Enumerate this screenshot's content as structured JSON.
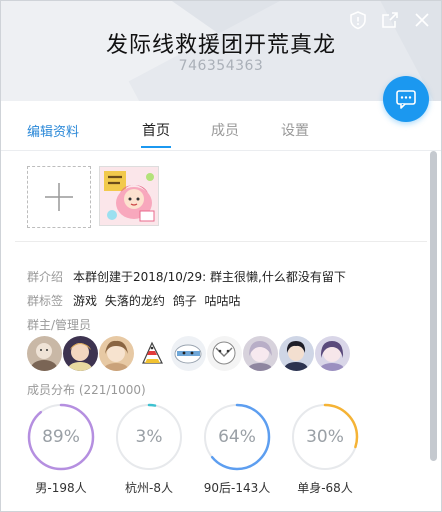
{
  "group": {
    "name": "发际线救援团开荒真龙",
    "id": "746354363"
  },
  "window_buttons": [
    "shield-icon",
    "share-icon",
    "close-icon"
  ],
  "tabs": {
    "edit_label": "编辑资料",
    "items": [
      {
        "label": "首页",
        "active": true
      },
      {
        "label": "成员",
        "active": false
      },
      {
        "label": "设置",
        "active": false
      }
    ]
  },
  "info": {
    "intro_label": "群介绍",
    "intro_text": "本群创建于2018/10/29:  群主很懒,什么都没有留下",
    "tags_label": "群标签",
    "tags": [
      "游戏",
      "失落的龙约",
      "鸽子",
      "咕咕咕"
    ]
  },
  "admins": {
    "title": "群主/管理员",
    "count": 9
  },
  "distribution": {
    "title": "成员分布",
    "summary": "(221/1000)",
    "items": [
      {
        "value": "89%",
        "percent": 89,
        "label": "男-198人",
        "color": "#b58fe0"
      },
      {
        "value": "3%",
        "percent": 3,
        "label": "杭州-8人",
        "color": "#3ec1d0"
      },
      {
        "value": "64%",
        "percent": 64,
        "label": "90后-143人",
        "color": "#5d9ef0"
      },
      {
        "value": "30%",
        "percent": 30,
        "label": "单身-68人",
        "color": "#f5b335"
      }
    ]
  },
  "colors": {
    "accent": "#1b98f0",
    "link": "#2a88d8"
  }
}
